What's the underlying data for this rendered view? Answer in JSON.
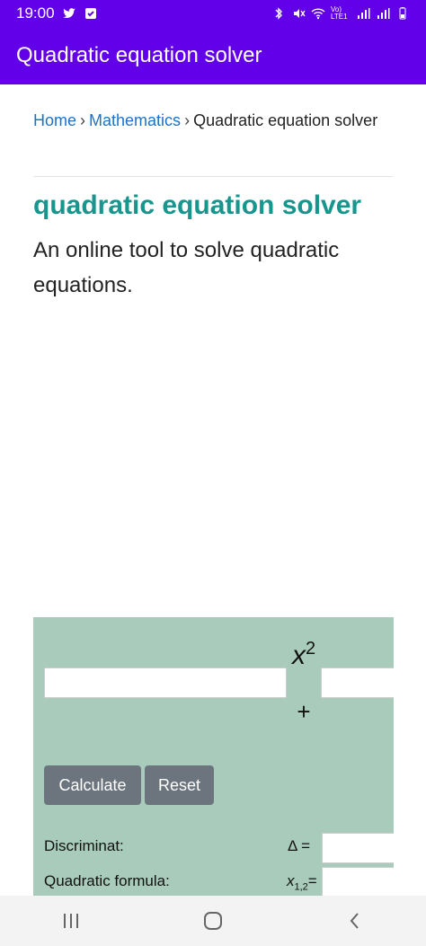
{
  "status_bar": {
    "time": "19:00",
    "network_label": "Vo) LTE1"
  },
  "app_bar": {
    "title": "Quadratic equation solver"
  },
  "breadcrumb": {
    "home": "Home",
    "separator": "›",
    "mathematics": "Mathematics",
    "current": "Quadratic equation solver"
  },
  "page": {
    "heading": "quadratic equation solver",
    "description": "An online tool to solve quadratic equations."
  },
  "calculator": {
    "x_symbol": "x",
    "x_exponent": "2",
    "plus_symbol": "+",
    "calculate_label": "Calculate",
    "reset_label": "Reset",
    "discriminant_label": "Discriminat:",
    "discriminant_symbol": "Δ =",
    "formula_label": "Quadratic formula:",
    "formula_symbol": "x",
    "formula_subscript": "1,2",
    "formula_equals": "=",
    "panel_color": "#a8cbbb"
  },
  "colors": {
    "app_bar": "#6200ea",
    "heading": "#17968e",
    "link": "#1a73c8",
    "button": "#6c757d"
  },
  "nav_bar": {
    "icons": [
      "recent-apps-icon",
      "home-icon",
      "back-icon"
    ]
  }
}
